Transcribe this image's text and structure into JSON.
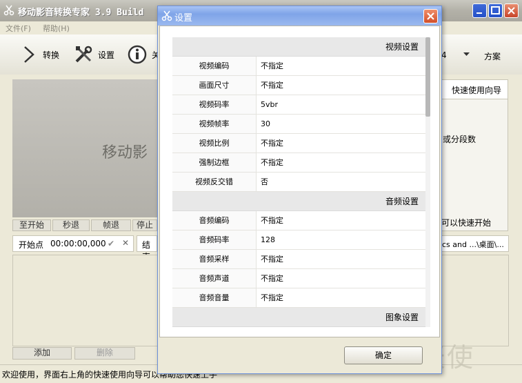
{
  "main_window": {
    "title": "移动影音转换专家 3.9 Build",
    "menu": [
      "文件(F)",
      "帮助(H)"
    ],
    "toolbar": {
      "convert": "转换",
      "settings": "设置",
      "about_partial": "关",
      "number_partial": "4",
      "scheme": "方案"
    },
    "preview_text": "移动影",
    "controls": [
      "至开始",
      "秒退",
      "帧退",
      "停止"
    ],
    "start_label": "开始点",
    "start_time": "00:00:00,000",
    "end_label": "结束",
    "path_text": "cs and ...\\桌面\\...",
    "right_panel": {
      "quick_guide": "快速使用向导",
      "split_text": "或分段数",
      "quick_start": "可以快速开始"
    },
    "list_buttons": [
      "添加",
      "删除"
    ],
    "status_text": "欢迎使用，界面右上角的快速使用向导可以帮助您快速上手"
  },
  "dialog": {
    "title": "设置",
    "sections": [
      {
        "title": "视频设置",
        "rows": [
          {
            "key": "视频编码",
            "value": "不指定"
          },
          {
            "key": "画面尺寸",
            "value": "不指定"
          },
          {
            "key": "视频码率",
            "value": "5vbr"
          },
          {
            "key": "视频帧率",
            "value": "30"
          },
          {
            "key": "视频比例",
            "value": "不指定"
          },
          {
            "key": "强制边框",
            "value": "不指定"
          },
          {
            "key": "视频反交错",
            "value": "否"
          }
        ]
      },
      {
        "title": "音频设置",
        "rows": [
          {
            "key": "音频编码",
            "value": "不指定"
          },
          {
            "key": "音频码率",
            "value": "128"
          },
          {
            "key": "音频采样",
            "value": "不指定"
          },
          {
            "key": "音频声道",
            "value": "不指定"
          },
          {
            "key": "音频音量",
            "value": "不指定"
          }
        ]
      },
      {
        "title": "图象设置",
        "rows": []
      }
    ],
    "ok_label": "确定"
  },
  "watermark": "天使",
  "colors": {
    "dialog_title": "#7fa4e8",
    "close_button": "#d24f2a",
    "window_bg": "#ece9d8"
  }
}
